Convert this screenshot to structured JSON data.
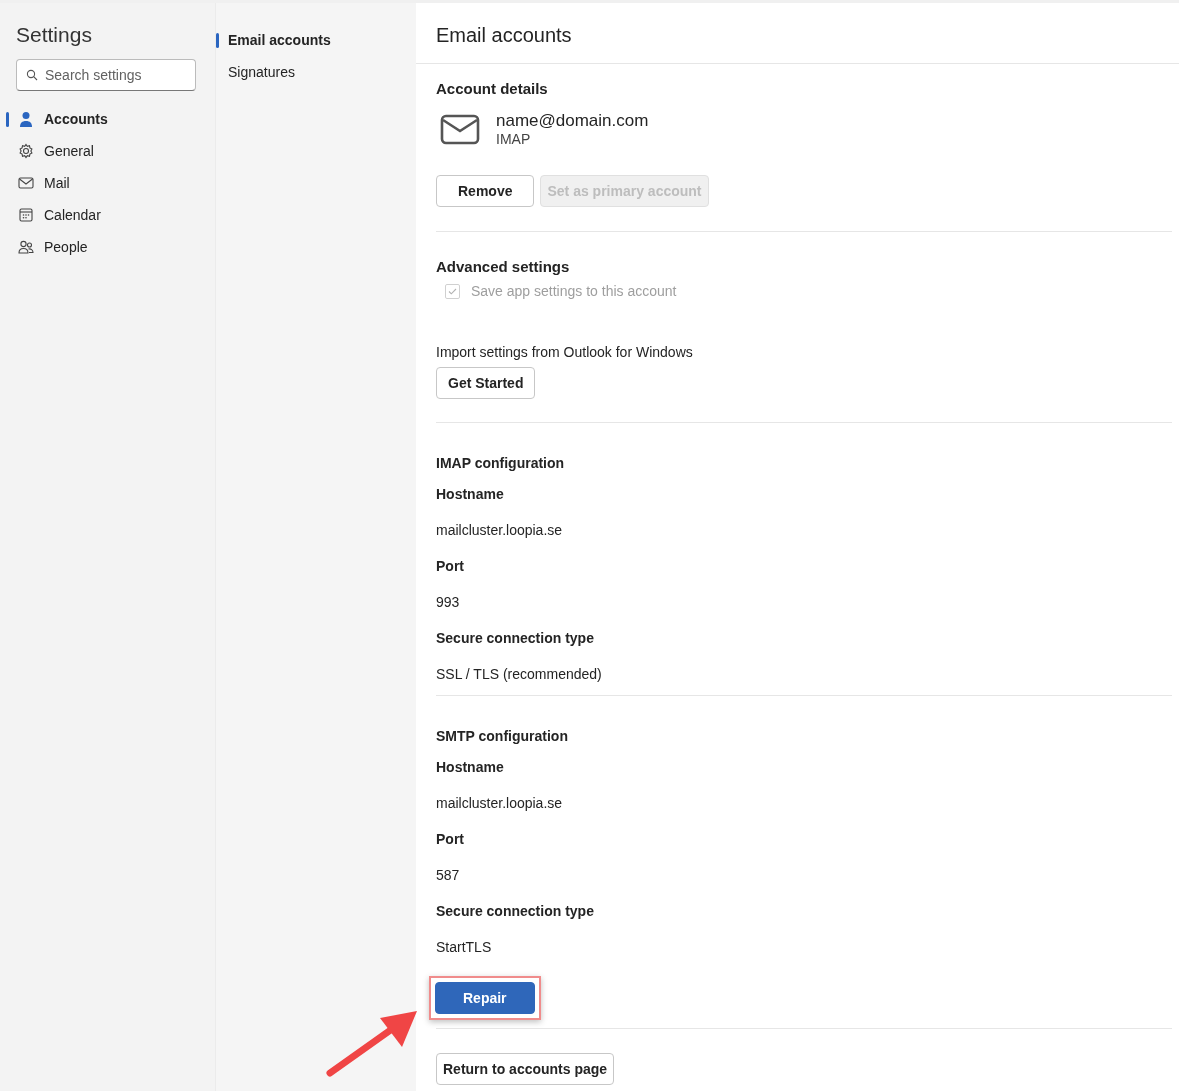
{
  "sidebar": {
    "title": "Settings",
    "search": {
      "placeholder": "Search settings"
    },
    "items": [
      {
        "label": "Accounts",
        "selected": true
      },
      {
        "label": "General",
        "selected": false
      },
      {
        "label": "Mail",
        "selected": false
      },
      {
        "label": "Calendar",
        "selected": false
      },
      {
        "label": "People",
        "selected": false
      }
    ]
  },
  "subnav": {
    "items": [
      {
        "label": "Email accounts",
        "selected": true
      },
      {
        "label": "Signatures",
        "selected": false
      }
    ]
  },
  "main": {
    "title": "Email accounts",
    "account_details": {
      "heading": "Account details",
      "email": "name@domain.com",
      "type": "IMAP",
      "buttons": [
        {
          "label": "Remove",
          "disabled": false
        },
        {
          "label": "Set as primary account",
          "disabled": true
        }
      ]
    },
    "advanced": {
      "heading": "Advanced settings",
      "checkbox": {
        "label": "Save app settings to this account",
        "checked": true,
        "disabled": true
      },
      "import_label": "Import settings from Outlook for Windows",
      "import_button": "Get Started"
    },
    "configs": [
      {
        "heading": "IMAP configuration",
        "fields": [
          {
            "label": "Hostname",
            "value": "mailcluster.loopia.se"
          },
          {
            "label": "Port",
            "value": "993"
          },
          {
            "label": "Secure connection type",
            "value": "SSL / TLS (recommended)"
          }
        ]
      },
      {
        "heading": "SMTP configuration",
        "fields": [
          {
            "label": "Hostname",
            "value": "mailcluster.loopia.se"
          },
          {
            "label": "Port",
            "value": "587"
          },
          {
            "label": "Secure connection type",
            "value": "StartTLS"
          }
        ]
      }
    ],
    "repair_button": {
      "label": "Repair",
      "highlighted": true
    },
    "return_button": "Return to accounts page"
  }
}
